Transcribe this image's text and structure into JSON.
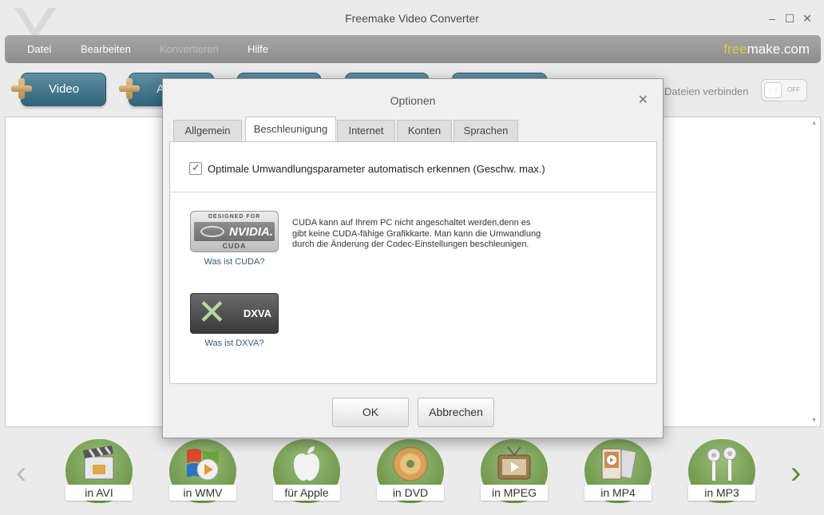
{
  "window": {
    "title": "Freemake Video Converter",
    "controls": [
      "minimize-icon",
      "maximize-icon",
      "close-icon"
    ]
  },
  "menu": {
    "items": [
      {
        "label": "Datei",
        "enabled": true
      },
      {
        "label": "Bearbeiten",
        "enabled": true
      },
      {
        "label": "Konvertieren",
        "enabled": false
      },
      {
        "label": "Hilfe",
        "enabled": true
      }
    ],
    "brand_part1": "free",
    "brand_part2": "make.com"
  },
  "toolbar": {
    "video_label": "Video",
    "audio_label": "A",
    "join_label": "Dateien verbinden",
    "join_toggle": "OFF"
  },
  "formats": [
    {
      "label": "in AVI",
      "icon": "clapperboard-icon"
    },
    {
      "label": "in WMV",
      "icon": "windows-media-icon"
    },
    {
      "label": "für Apple",
      "icon": "apple-icon"
    },
    {
      "label": "in DVD",
      "icon": "dvd-disc-icon"
    },
    {
      "label": "in MPEG",
      "icon": "tv-icon"
    },
    {
      "label": "in MP4",
      "icon": "media-player-icon"
    },
    {
      "label": "in MP3",
      "icon": "earphones-icon"
    }
  ],
  "dialog": {
    "title": "Optionen",
    "tabs": [
      {
        "label": "Allgemein",
        "active": false
      },
      {
        "label": "Beschleunigung",
        "active": true
      },
      {
        "label": "Internet",
        "active": false
      },
      {
        "label": "Konten",
        "active": false
      },
      {
        "label": "Sprachen",
        "active": false
      }
    ],
    "auto_detect_label": "Optimale Umwandlungsparameter automatisch erkennen (Geschw. max.)",
    "auto_detect_checked": true,
    "cuda": {
      "logo_top": "DESIGNED FOR",
      "logo_brand": "NVIDIA.",
      "logo_bottom": "CUDA",
      "link": "Was ist CUDA?",
      "text": "CUDA kann auf Ihrem PC nicht angeschaltet werden,denn es\ngibt keine CUDA-fähige Grafikkarte. Man kann die Umwandlung\ndurch die Änderung der Codec-Einstellungen beschleunigen."
    },
    "dxva": {
      "logo_text": "DXVA",
      "link": "Was ist DXVA?"
    },
    "ok_label": "OK",
    "cancel_label": "Abbrechen"
  },
  "colors": {
    "toolbar_button": "#3d7388",
    "format_circle": "#7aa257",
    "brand_accent": "#d7cb4c",
    "link": "#2f5d7a"
  }
}
